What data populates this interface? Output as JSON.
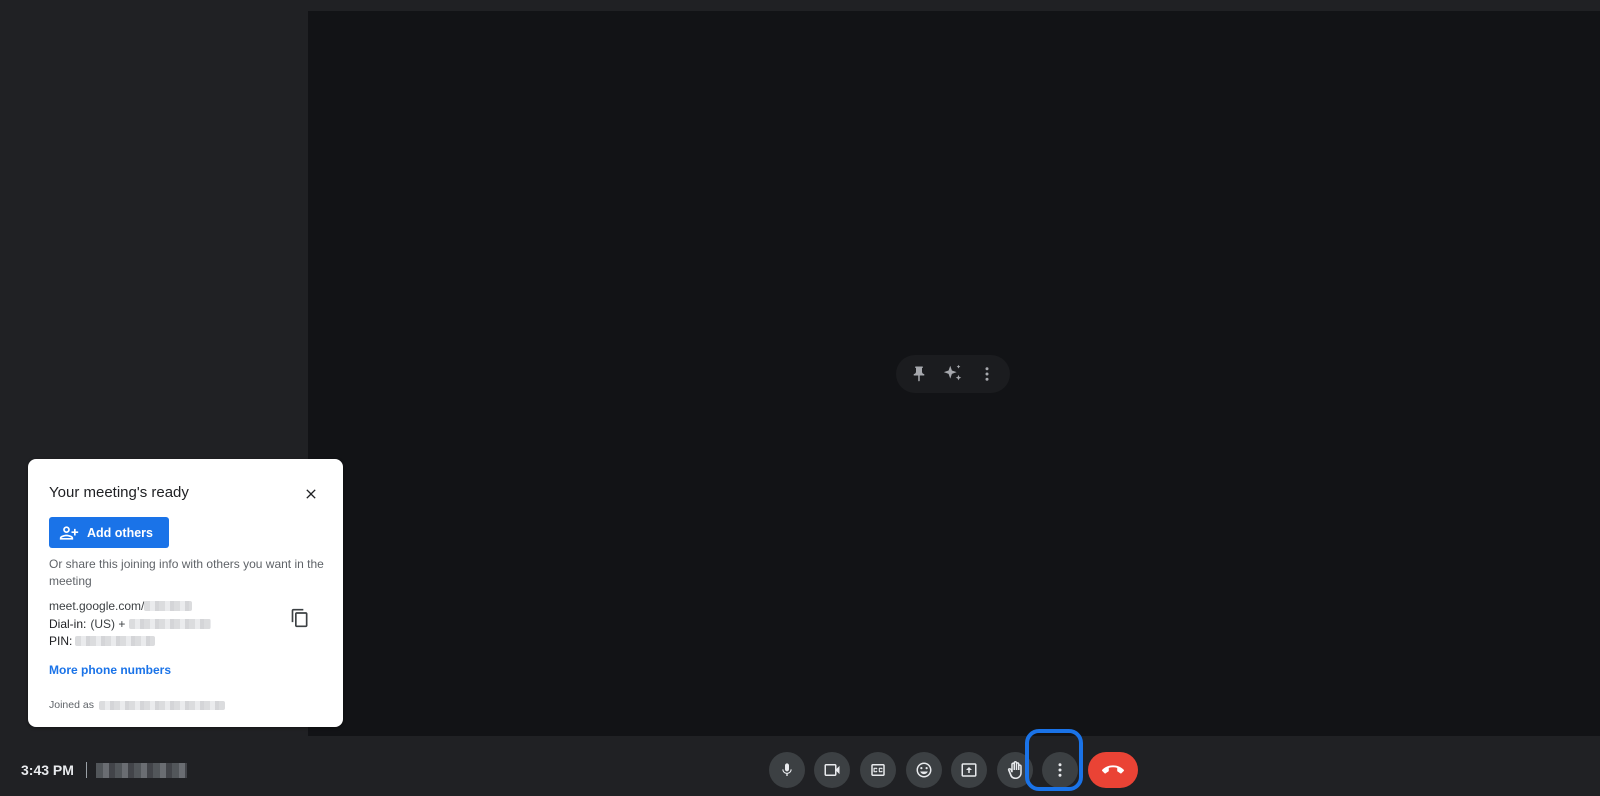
{
  "tile_menu": {
    "icons": [
      "pin-icon",
      "sparkle-effects-icon",
      "more-vert-icon"
    ]
  },
  "panel": {
    "title": "Your meeting's ready",
    "add_others_label": "Add others",
    "share_text": "Or share this joining info with others you want in the meeting",
    "meeting_link_prefix": "meet.google.com/",
    "dial_in_label": "Dial-in:",
    "dial_in_value": "(US) +",
    "pin_label": "PIN:",
    "more_phone_numbers": "More phone numbers",
    "joined_as_label": "Joined as"
  },
  "status": {
    "time": "3:43 PM"
  },
  "controls": [
    {
      "name": "microphone-button",
      "icon": "mic-icon"
    },
    {
      "name": "camera-button",
      "icon": "videocam-icon"
    },
    {
      "name": "captions-button",
      "icon": "closed-caption-icon"
    },
    {
      "name": "reactions-button",
      "icon": "emoji-icon"
    },
    {
      "name": "present-button",
      "icon": "present-screen-icon"
    },
    {
      "name": "raise-hand-button",
      "icon": "hand-icon"
    },
    {
      "name": "more-options-button",
      "icon": "more-vert-icon"
    },
    {
      "name": "leave-call-button",
      "icon": "call-end-icon"
    }
  ],
  "colors": {
    "background": "#202124",
    "stage": "#121316",
    "accent": "#1a73e8",
    "end_call": "#ea4335"
  }
}
